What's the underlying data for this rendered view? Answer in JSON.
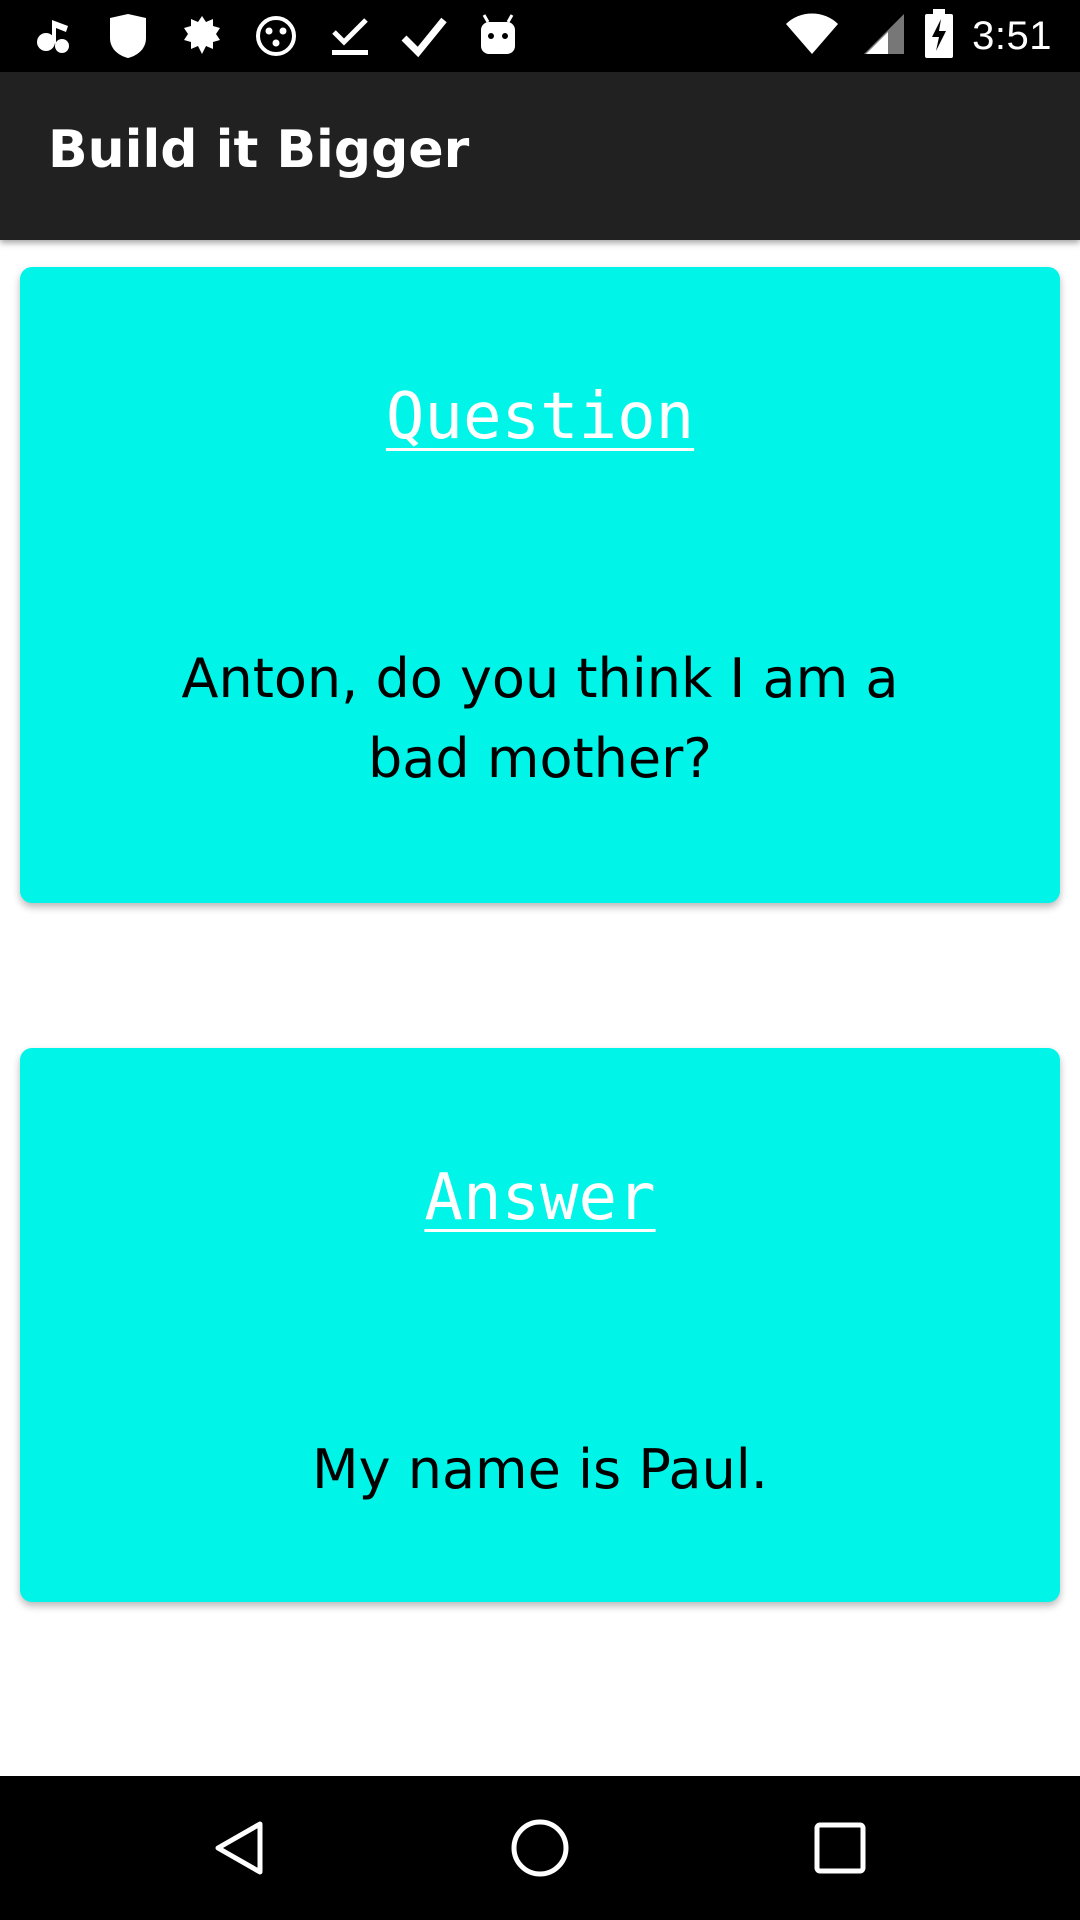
{
  "status_bar": {
    "time": "3:51",
    "left_icons": [
      "music-note-icon",
      "shield-icon",
      "badge-icon",
      "face-icon",
      "download-done-icon",
      "check-icon",
      "android-icon"
    ],
    "right_icons": [
      "wifi-icon",
      "signal-icon",
      "battery-charging-icon"
    ]
  },
  "app_bar": {
    "title": "Build it Bigger",
    "background": "#212121"
  },
  "question_card": {
    "heading": "Question",
    "text": "Anton, do you think I am a bad mother?",
    "background": "#00f5e8"
  },
  "answer_card": {
    "heading": "Answer",
    "text": "My name is Paul.",
    "background": "#00f5e8"
  },
  "nav_bar": {
    "buttons": [
      "back-icon",
      "home-icon",
      "recent-apps-icon"
    ]
  }
}
